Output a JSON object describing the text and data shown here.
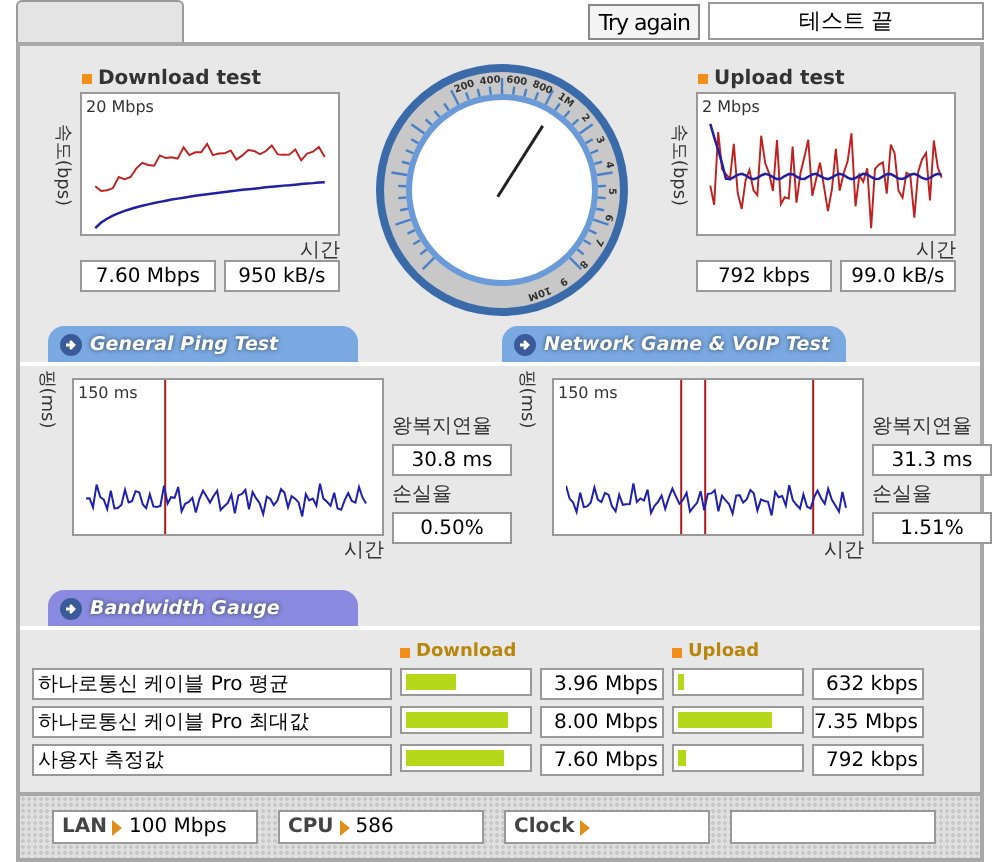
{
  "top_bar": {
    "button": "Try again",
    "status": "테스트 끝"
  },
  "speed_tests": [
    {
      "title": "Download test",
      "scale": "20 Mbps",
      "y_axis": "속도(bps)",
      "x_axis": "시간",
      "readings": [
        "7.60 Mbps",
        "950 kB/s"
      ]
    },
    {
      "title": "Upload test",
      "scale": "2 Mbps",
      "y_axis": "속도(bps)",
      "x_axis": "시간",
      "readings": [
        "792 kbps",
        "99.0 kB/s"
      ]
    }
  ],
  "gauge": {
    "level": 0.62,
    "labels": [
      "200",
      "400",
      "600",
      "800",
      "1M",
      "2",
      "3",
      "4",
      "5",
      "6",
      "7",
      "8",
      "9",
      "10M"
    ]
  },
  "ping_tests": [
    {
      "tab": "General Ping Test",
      "scale": "150 ms",
      "y_axis": "핑(ms)",
      "x_axis": "시간",
      "latency_label": "왕복지연율",
      "latency": "30.8 ms",
      "loss_label": "손실율",
      "loss": "0.50%"
    },
    {
      "tab": "Network Game & VoIP Test",
      "scale": "150 ms",
      "y_axis": "핑(ms)",
      "x_axis": "시간",
      "latency_label": "왕복지연율",
      "latency": "31.3 ms",
      "loss_label": "손실율",
      "loss": "1.51%"
    }
  ],
  "bandwidth": {
    "tab": "Bandwidth Gauge",
    "download_title": "Download",
    "upload_title": "Upload",
    "rows": [
      {
        "name": "하나로통신 케이블 Pro 평균",
        "download": {
          "level": 0.41,
          "reading": "3.96 Mbps"
        },
        "upload": {
          "level": 0.05,
          "reading": "632 kbps"
        }
      },
      {
        "name": "하나로통신 케이블 Pro 최대값",
        "download": {
          "level": 0.85,
          "reading": "8.00 Mbps"
        },
        "upload": {
          "level": 0.78,
          "reading": "7.35 Mbps"
        }
      },
      {
        "name": "사용자 측정값",
        "download": {
          "level": 0.81,
          "reading": "7.60 Mbps"
        },
        "upload": {
          "level": 0.07,
          "reading": "792 kbps"
        }
      }
    ]
  },
  "status_bar": [
    {
      "label": "LAN",
      "value": "100 Mbps"
    },
    {
      "label": "CPU",
      "value": "586"
    },
    {
      "label": "Clock"
    }
  ]
}
